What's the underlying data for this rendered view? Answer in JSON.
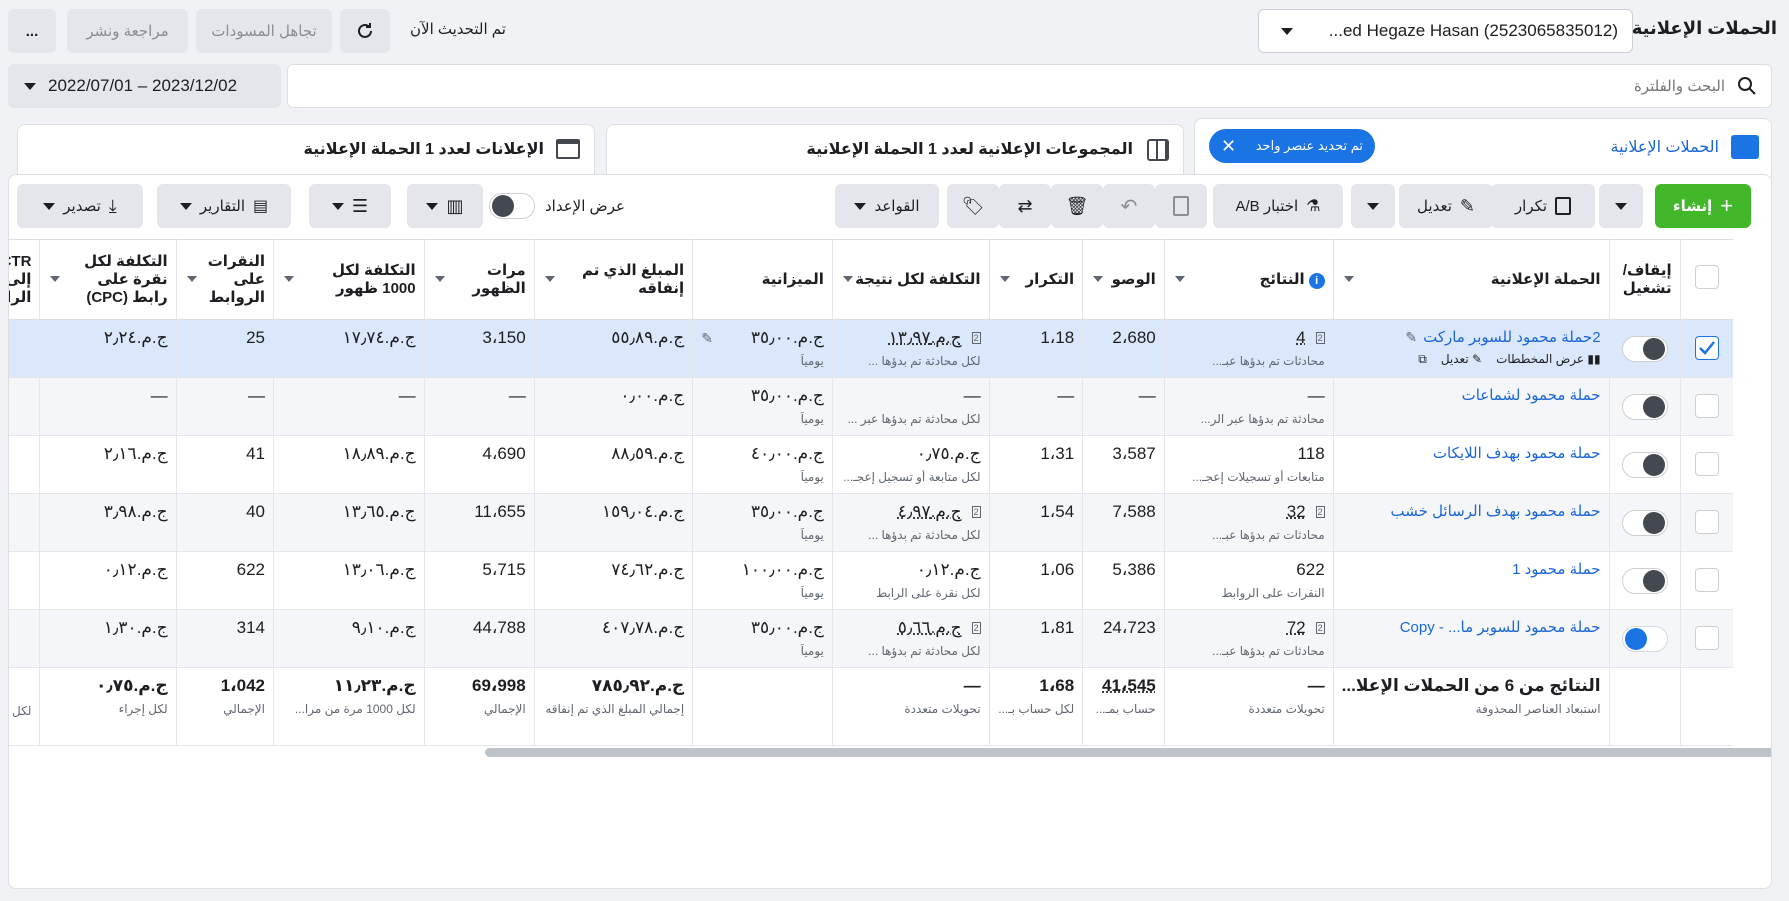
{
  "header": {
    "title": "الحملات الإعلانية",
    "account_label": "...ed Hegaze Hasan (2523065835012)",
    "updated_text": "تم التحديث الآن",
    "discard_drafts": "تجاهل المسودات",
    "review_publish": "مراجعة ونشر",
    "more": "..."
  },
  "search": {
    "placeholder": "البحث والفلترة"
  },
  "date_range": "2022/07/01 – 2023/12/02",
  "tabs": {
    "campaigns": "الحملات الإعلانية",
    "selected_chip": "تم تحديد عنصر واحد",
    "adsets": "المجموعات الإعلانية لعدد 1 الحملة الإعلانية",
    "ads": "الإعلانات لعدد 1 الحملة الإعلانية"
  },
  "toolbar": {
    "create": "إنشاء",
    "duplicate": "تكرار",
    "edit": "تعديل",
    "ab_test": "اختبار A/B",
    "rules": "القواعد",
    "setup_view": "عرض الإعداد",
    "reports": "التقارير",
    "export": "تصدير"
  },
  "columns": {
    "onoff": "إيقاف/ تشغيل",
    "campaign": "الحملة الإعلانية",
    "results": "النتائج",
    "reach": "الوصو",
    "frequency": "التكرار",
    "cost_per_result": "التكلفة لكل نتيجة",
    "budget": "الميزانية",
    "amount_spent": "المبلغ الذي تم إنفاقه",
    "impressions": "مرات الظهور",
    "cpm": "التكلفة لكل 1000 ظهور",
    "link_clicks": "النقرات على الروابط",
    "cpc": "التكلفة لكل نقرة على رابط (CPC)",
    "ctr": "CTR إلى الرا"
  },
  "row_actions": {
    "view_charts": "عرض المخططات",
    "edit": "تعديل"
  },
  "rows": [
    {
      "name": "2حملة محمود للسوبر ماركت",
      "results": "4",
      "results_sub": "محادثات تم بدؤها عبـ...",
      "reach": "2،680",
      "freq": "1،18",
      "cpr": "ج.م.١٣٫٩٧",
      "cpr_sub": "لكل محادثة تم بدؤها ...",
      "budget": "ج.م.٣٥٫٠٠",
      "budget_sub": "يومياً",
      "spent": "ج.م.٥٥٫٨٩",
      "impr": "3،150",
      "cpm": "ج.م.١٧٫٧٤",
      "clicks": "25",
      "cpc": "ج.م.٢٫٢٤",
      "checked": true,
      "on": true
    },
    {
      "name": "حملة محمود لشماعات",
      "results": "—",
      "results_sub": "محادثة تم بدؤها عبر الر...",
      "reach": "—",
      "freq": "—",
      "cpr": "—",
      "cpr_sub": "لكل محادثة تم بدؤها عبر ...",
      "budget": "ج.م.٣٥٫٠٠",
      "budget_sub": "يومياً",
      "spent": "ج.م.٠٫٠٠",
      "impr": "—",
      "cpm": "—",
      "clicks": "—",
      "cpc": "—",
      "checked": false,
      "on": true
    },
    {
      "name": "حملة محمود بهدف اللايكات",
      "results": "118",
      "results_sub": "متابعات أو تسجيلات إعجـ...",
      "reach": "3،587",
      "freq": "1،31",
      "cpr": "ج.م.٠٫٧٥",
      "cpr_sub": "لكل متابعة أو تسجيل إعجـ...",
      "budget": "ج.م.٤٠٫٠٠",
      "budget_sub": "يومياً",
      "spent": "ج.م.٨٨٫٥٩",
      "impr": "4،690",
      "cpm": "ج.م.١٨٫٨٩",
      "clicks": "41",
      "cpc": "ج.م.٢٫١٦",
      "checked": false,
      "on": true
    },
    {
      "name": "حملة محمود بهدف الرسائل خشب",
      "results": "32",
      "results_sub": "محادثات تم بدؤها عبـ...",
      "reach": "7،588",
      "freq": "1،54",
      "cpr": "ج.م.٤٫٩٧",
      "cpr_sub": "لكل محادثة تم بدؤها ...",
      "budget": "ج.م.٣٥٫٠٠",
      "budget_sub": "يومياً",
      "spent": "ج.م.١٥٩٫٠٤",
      "impr": "11،655",
      "cpm": "ج.م.١٣٫٦٥",
      "clicks": "40",
      "cpc": "ج.م.٣٫٩٨",
      "checked": false,
      "on": true
    },
    {
      "name": "حملة محمود 1",
      "results": "622",
      "results_sub": "النقرات على الروابط",
      "reach": "5،386",
      "freq": "1،06",
      "cpr": "ج.م.٠٫١٢",
      "cpr_sub": "لكل نقرة على الرابط",
      "budget": "ج.م.١٠٠٫٠٠",
      "budget_sub": "يومياً",
      "spent": "ج.م.٧٤٫٦٢",
      "impr": "5،715",
      "cpm": "ج.م.١٣٫٠٦",
      "clicks": "622",
      "cpc": "ج.م.٠٫١٢",
      "checked": false,
      "on": true
    },
    {
      "name": "حملة محمود للسوبر ما... - Copy",
      "results": "72",
      "results_sub": "محادثات تم بدؤها عبـ...",
      "reach": "24،723",
      "freq": "1،81",
      "cpr": "ج.م.٥٫٦٦",
      "cpr_sub": "لكل محادثة تم بدؤها ...",
      "budget": "ج.م.٣٥٫٠٠",
      "budget_sub": "يومياً",
      "spent": "ج.م.٤٠٧٫٧٨",
      "impr": "44،788",
      "cpm": "ج.م.٩٫١٠",
      "clicks": "314",
      "cpc": "ج.م.١٫٣٠",
      "checked": false,
      "on": false
    }
  ],
  "totals": {
    "label": "النتائج من 6 من الحملات الإعلا...",
    "label_sub": "استبعاد العناصر المحذوفة",
    "results": "—",
    "results_sub": "تحويلات متعددة",
    "reach": "41،545",
    "reach_sub": "حساب بمـ...",
    "freq": "1،68",
    "freq_sub": "لكل حساب بـ...",
    "cpr": "—",
    "cpr_sub": "تحويلات متعددة",
    "spent": "ج.م.٧٨٥٫٩٢",
    "spent_sub": "إجمالي المبلغ الذي تم إنفاقه",
    "impr": "69،998",
    "impr_sub": "الإجمالي",
    "cpm": "ج.م.١١٫٢٣",
    "cpm_sub": "لكل 1000 مرة من مرا...",
    "clicks": "1،042",
    "clicks_sub": "الإجمالي",
    "cpc": "ج.م.٠٫٧٥",
    "cpc_sub": "لكل إجراء",
    "ctr_sub": "لكل"
  },
  "colors": {
    "accent": "#1b74e4",
    "green": "#42b72a",
    "selected_row": "#dbe7fb"
  }
}
